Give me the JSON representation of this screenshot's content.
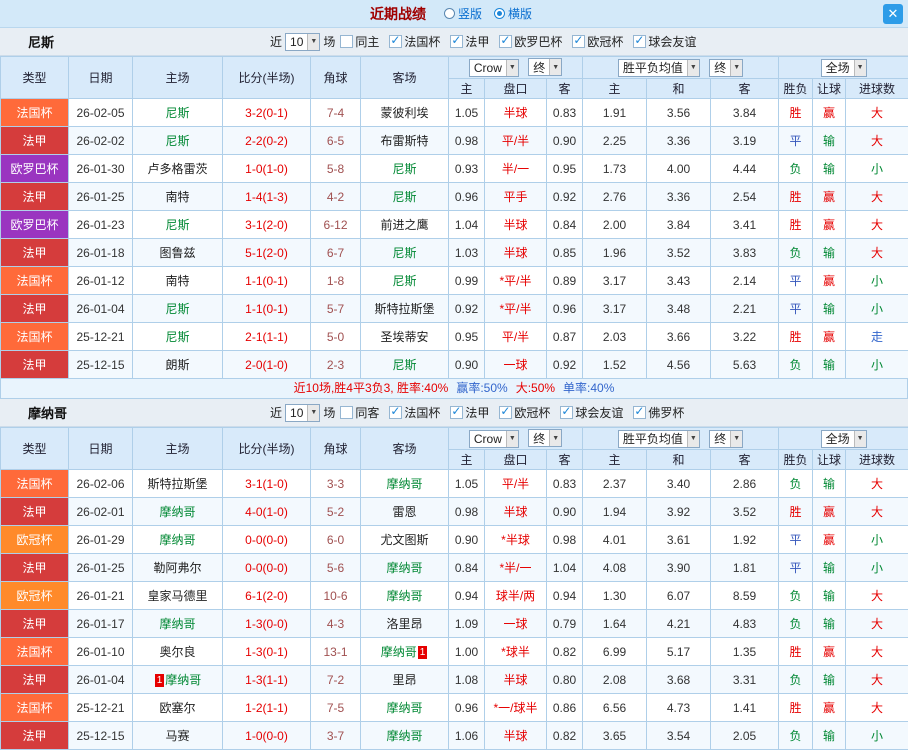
{
  "topbar": {
    "title": "近期战绩",
    "vertical_label": "竖版",
    "horizontal_label": "横版",
    "vertical_selected": false,
    "horizontal_selected": true,
    "close_icon": "✕"
  },
  "filter_labels": {
    "near": "近",
    "matches": "场"
  },
  "table_header": {
    "cols": [
      "类型",
      "日期",
      "主场",
      "比分(半场)",
      "角球",
      "客场"
    ],
    "sub": [
      "主",
      "盘口",
      "客",
      "主",
      "和",
      "客",
      "胜负",
      "让球",
      "进球数"
    ],
    "company": "Crow",
    "final1": "终",
    "avg": "胜平负均值",
    "final2": "终",
    "scope": "全场"
  },
  "league_colors": {
    "法国杯": "#ff6a3a",
    "法甲": "#d53c3c",
    "欧罗巴杯": "#9a35c0",
    "欧冠杯": "#ff8a2a"
  },
  "outcome_colors": {
    "胜": "#e60000",
    "赢": "#e60000",
    "大": "#e60000",
    "平": "#3355bb",
    "走": "#3366cc",
    "负": "#008833",
    "输": "#008833",
    "小": "#008833"
  },
  "sections": [
    {
      "team": "尼斯",
      "count": "10",
      "same_label": "同主",
      "same_checked": false,
      "leagues": [
        {
          "label": "法国杯",
          "checked": true
        },
        {
          "label": "法甲",
          "checked": true
        },
        {
          "label": "欧罗巴杯",
          "checked": true
        },
        {
          "label": "欧冠杯",
          "checked": true
        },
        {
          "label": "球会友谊",
          "checked": true
        }
      ],
      "rows": [
        {
          "league": "法国杯",
          "date": "26-02-05",
          "home": "尼斯",
          "score": "3-2(0-1)",
          "corners": "7-4",
          "away": "蒙彼利埃",
          "w_home": "1.05",
          "line": "半球",
          "w_away": "0.83",
          "avg_home": "1.91",
          "avg_draw": "3.56",
          "avg_away": "3.84",
          "result": "胜",
          "line_result": "赢",
          "goal_result": "大"
        },
        {
          "league": "法甲",
          "date": "26-02-02",
          "home": "尼斯",
          "score": "2-2(0-2)",
          "corners": "6-5",
          "away": "布雷斯特",
          "w_home": "0.98",
          "line": "平/半",
          "w_away": "0.90",
          "avg_home": "2.25",
          "avg_draw": "3.36",
          "avg_away": "3.19",
          "result": "平",
          "line_result": "输",
          "goal_result": "大"
        },
        {
          "league": "欧罗巴杯",
          "date": "26-01-30",
          "home": "卢多格雷茨",
          "score": "1-0(1-0)",
          "corners": "5-8",
          "away": "尼斯",
          "w_home": "0.93",
          "line": "半/一",
          "w_away": "0.95",
          "avg_home": "1.73",
          "avg_draw": "4.00",
          "avg_away": "4.44",
          "result": "负",
          "line_result": "输",
          "goal_result": "小"
        },
        {
          "league": "法甲",
          "date": "26-01-25",
          "home": "南特",
          "score": "1-4(1-3)",
          "corners": "4-2",
          "away": "尼斯",
          "w_home": "0.96",
          "line": "平手",
          "w_away": "0.92",
          "avg_home": "2.76",
          "avg_draw": "3.36",
          "avg_away": "2.54",
          "result": "胜",
          "line_result": "赢",
          "goal_result": "大"
        },
        {
          "league": "欧罗巴杯",
          "date": "26-01-23",
          "home": "尼斯",
          "score": "3-1(2-0)",
          "corners": "6-12",
          "away": "前进之鹰",
          "w_home": "1.04",
          "line": "半球",
          "w_away": "0.84",
          "avg_home": "2.00",
          "avg_draw": "3.84",
          "avg_away": "3.41",
          "result": "胜",
          "line_result": "赢",
          "goal_result": "大"
        },
        {
          "league": "法甲",
          "date": "26-01-18",
          "home": "图鲁兹",
          "score": "5-1(2-0)",
          "corners": "6-7",
          "away": "尼斯",
          "w_home": "1.03",
          "line": "半球",
          "w_away": "0.85",
          "avg_home": "1.96",
          "avg_draw": "3.52",
          "avg_away": "3.83",
          "result": "负",
          "line_result": "输",
          "goal_result": "大"
        },
        {
          "league": "法国杯",
          "date": "26-01-12",
          "home": "南特",
          "score": "1-1(0-1)",
          "corners": "1-8",
          "away": "尼斯",
          "w_home": "0.99",
          "line": "*平/半",
          "w_away": "0.89",
          "avg_home": "3.17",
          "avg_draw": "3.43",
          "avg_away": "2.14",
          "result": "平",
          "line_result": "赢",
          "goal_result": "小"
        },
        {
          "league": "法甲",
          "date": "26-01-04",
          "home": "尼斯",
          "score": "1-1(0-1)",
          "corners": "5-7",
          "away": "斯特拉斯堡",
          "w_home": "0.92",
          "line": "*平/半",
          "w_away": "0.96",
          "avg_home": "3.17",
          "avg_draw": "3.48",
          "avg_away": "2.21",
          "result": "平",
          "line_result": "输",
          "goal_result": "小"
        },
        {
          "league": "法国杯",
          "date": "25-12-21",
          "home": "尼斯",
          "score": "2-1(1-1)",
          "corners": "5-0",
          "away": "圣埃蒂安",
          "w_home": "0.95",
          "line": "平/半",
          "w_away": "0.87",
          "avg_home": "2.03",
          "avg_draw": "3.66",
          "avg_away": "3.22",
          "result": "胜",
          "line_result": "赢",
          "goal_result": "走"
        },
        {
          "league": "法甲",
          "date": "25-12-15",
          "home": "朗斯",
          "score": "2-0(1-0)",
          "corners": "2-3",
          "away": "尼斯",
          "w_home": "0.90",
          "line": "一球",
          "w_away": "0.92",
          "avg_home": "1.52",
          "avg_draw": "4.56",
          "avg_away": "5.63",
          "result": "负",
          "line_result": "输",
          "goal_result": "小"
        }
      ],
      "summary": [
        {
          "text": "近10场,胜4平3负3, 胜率:40%",
          "color": "#e60000"
        },
        {
          "text": "赢率:50%",
          "color": "#3366cc"
        },
        {
          "text": "大:50%",
          "color": "#e60000"
        },
        {
          "text": "单率:40%",
          "color": "#3366cc"
        }
      ]
    },
    {
      "team": "摩纳哥",
      "count": "10",
      "same_label": "同客",
      "same_checked": false,
      "leagues": [
        {
          "label": "法国杯",
          "checked": true
        },
        {
          "label": "法甲",
          "checked": true
        },
        {
          "label": "欧冠杯",
          "checked": true
        },
        {
          "label": "球会友谊",
          "checked": true
        },
        {
          "label": "佛罗杯",
          "checked": true
        }
      ],
      "rows": [
        {
          "league": "法国杯",
          "date": "26-02-06",
          "home": "斯特拉斯堡",
          "score": "3-1(1-0)",
          "corners": "3-3",
          "away": "摩纳哥",
          "w_home": "1.05",
          "line": "平/半",
          "w_away": "0.83",
          "avg_home": "2.37",
          "avg_draw": "3.40",
          "avg_away": "2.86",
          "result": "负",
          "line_result": "输",
          "goal_result": "大"
        },
        {
          "league": "法甲",
          "date": "26-02-01",
          "home": "摩纳哥",
          "score": "4-0(1-0)",
          "corners": "5-2",
          "away": "雷恩",
          "w_home": "0.98",
          "line": "半球",
          "w_away": "0.90",
          "avg_home": "1.94",
          "avg_draw": "3.92",
          "avg_away": "3.52",
          "result": "胜",
          "line_result": "赢",
          "goal_result": "大"
        },
        {
          "league": "欧冠杯",
          "date": "26-01-29",
          "home": "摩纳哥",
          "score": "0-0(0-0)",
          "corners": "6-0",
          "away": "尤文图斯",
          "w_home": "0.90",
          "line": "*半球",
          "w_away": "0.98",
          "avg_home": "4.01",
          "avg_draw": "3.61",
          "avg_away": "1.92",
          "result": "平",
          "line_result": "赢",
          "goal_result": "小"
        },
        {
          "league": "法甲",
          "date": "26-01-25",
          "home": "勒阿弗尔",
          "score": "0-0(0-0)",
          "corners": "5-6",
          "away": "摩纳哥",
          "w_home": "0.84",
          "line": "*半/一",
          "w_away": "1.04",
          "avg_home": "4.08",
          "avg_draw": "3.90",
          "avg_away": "1.81",
          "result": "平",
          "line_result": "输",
          "goal_result": "小"
        },
        {
          "league": "欧冠杯",
          "date": "26-01-21",
          "home": "皇家马德里",
          "score": "6-1(2-0)",
          "corners": "10-6",
          "away": "摩纳哥",
          "w_home": "0.94",
          "line": "球半/两",
          "w_away": "0.94",
          "avg_home": "1.30",
          "avg_draw": "6.07",
          "avg_away": "8.59",
          "result": "负",
          "line_result": "输",
          "goal_result": "大"
        },
        {
          "league": "法甲",
          "date": "26-01-17",
          "home": "摩纳哥",
          "score": "1-3(0-0)",
          "corners": "4-3",
          "away": "洛里昂",
          "w_home": "1.09",
          "line": "一球",
          "w_away": "0.79",
          "avg_home": "1.64",
          "avg_draw": "4.21",
          "avg_away": "4.83",
          "result": "负",
          "line_result": "输",
          "goal_result": "大"
        },
        {
          "league": "法国杯",
          "date": "26-01-10",
          "home": "奥尔良",
          "score": "1-3(0-1)",
          "corners": "13-1",
          "away": "摩纳哥",
          "away_card": "1",
          "w_home": "1.00",
          "line": "*球半",
          "w_away": "0.82",
          "avg_home": "6.99",
          "avg_draw": "5.17",
          "avg_away": "1.35",
          "result": "胜",
          "line_result": "赢",
          "goal_result": "大"
        },
        {
          "league": "法甲",
          "date": "26-01-04",
          "home": "摩纳哥",
          "home_card": "1",
          "score": "1-3(1-1)",
          "corners": "7-2",
          "away": "里昂",
          "w_home": "1.08",
          "line": "半球",
          "w_away": "0.80",
          "avg_home": "2.08",
          "avg_draw": "3.68",
          "avg_away": "3.31",
          "result": "负",
          "line_result": "输",
          "goal_result": "大"
        },
        {
          "league": "法国杯",
          "date": "25-12-21",
          "home": "欧塞尔",
          "score": "1-2(1-1)",
          "corners": "7-5",
          "away": "摩纳哥",
          "w_home": "0.96",
          "line": "*一/球半",
          "w_away": "0.86",
          "avg_home": "6.56",
          "avg_draw": "4.73",
          "avg_away": "1.41",
          "result": "胜",
          "line_result": "赢",
          "goal_result": "大"
        },
        {
          "league": "法甲",
          "date": "25-12-15",
          "home": "马赛",
          "score": "1-0(0-0)",
          "corners": "3-7",
          "away": "摩纳哥",
          "w_home": "1.06",
          "line": "半球",
          "w_away": "0.82",
          "avg_home": "3.65",
          "avg_draw": "3.54",
          "avg_away": "2.05",
          "result": "负",
          "line_result": "输",
          "goal_result": "小"
        }
      ]
    }
  ]
}
